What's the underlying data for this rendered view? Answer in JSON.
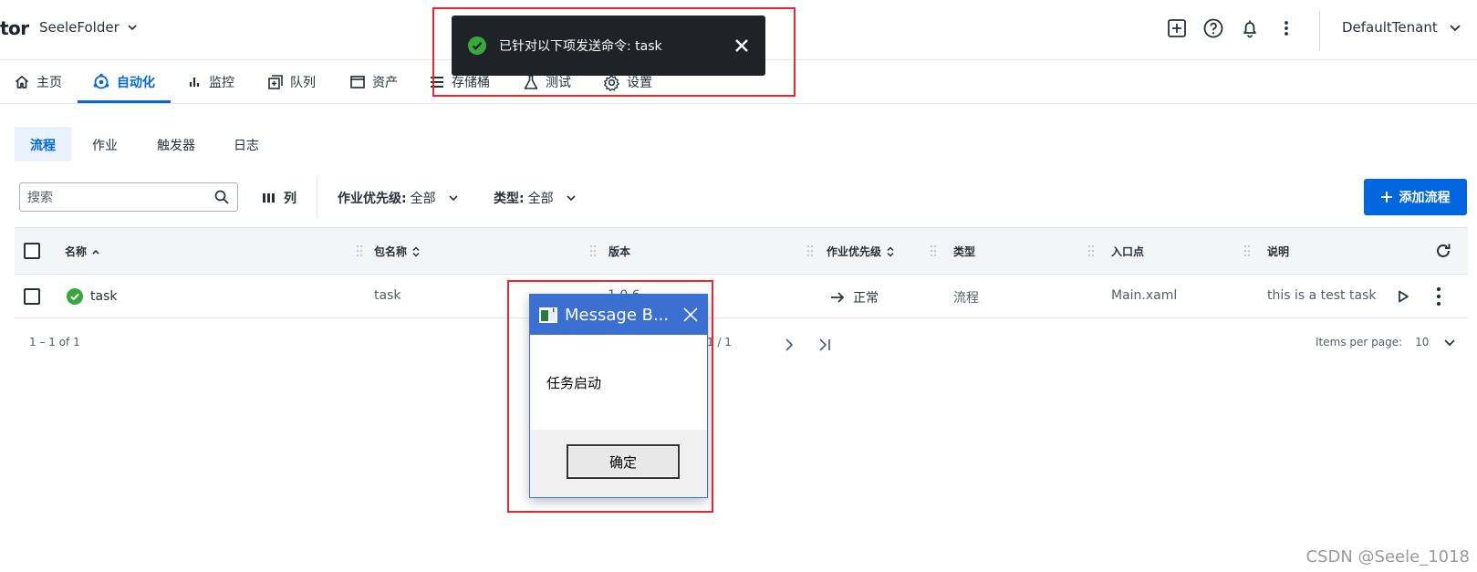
{
  "header": {
    "brand": "tor",
    "folder": "SeeleFolder",
    "tenant": "DefaultTenant"
  },
  "nav": {
    "items": [
      {
        "label": "主页",
        "icon": "home-icon"
      },
      {
        "label": "自动化",
        "icon": "automation-gear-icon",
        "active": true
      },
      {
        "label": "监控",
        "icon": "bar-chart-icon"
      },
      {
        "label": "队列",
        "icon": "queue-icon"
      },
      {
        "label": "资产",
        "icon": "asset-window-icon"
      },
      {
        "label": "存储桶",
        "icon": "storage-list-icon"
      },
      {
        "label": "测试",
        "icon": "flask-icon"
      },
      {
        "label": "设置",
        "icon": "gear-icon"
      }
    ]
  },
  "subtabs": [
    "流程",
    "作业",
    "触发器",
    "日志"
  ],
  "toolbar": {
    "search_placeholder": "搜索",
    "columns_label": "列",
    "filter_priority_key": "作业优先级:",
    "filter_priority_value": "全部",
    "filter_type_key": "类型:",
    "filter_type_value": "全部",
    "add_label": "添加流程"
  },
  "table": {
    "columns": [
      "名称",
      "包名称",
      "版本",
      "作业优先级",
      "类型",
      "入口点",
      "说明"
    ],
    "rows": [
      {
        "name": "task",
        "package": "task",
        "version": "1.0.6",
        "priority": "正常",
        "type": "流程",
        "entry": "Main.xaml",
        "description": "this is a test task"
      }
    ]
  },
  "pager": {
    "range": "1 – 1 of 1",
    "page": "1 / 1",
    "items_per_page_label": "Items per page:",
    "items_per_page_value": "10"
  },
  "toast": {
    "message": "已针对以下项发送命令: task"
  },
  "message_box": {
    "title": "Message B...",
    "body": "任务启动",
    "ok_label": "确定"
  },
  "watermark": "CSDN @Seele_1018",
  "colors": {
    "accent": "#0067df",
    "success": "#38a83b",
    "highlight_box": "#e8262b",
    "dialog_title": "#3b6fd1"
  }
}
